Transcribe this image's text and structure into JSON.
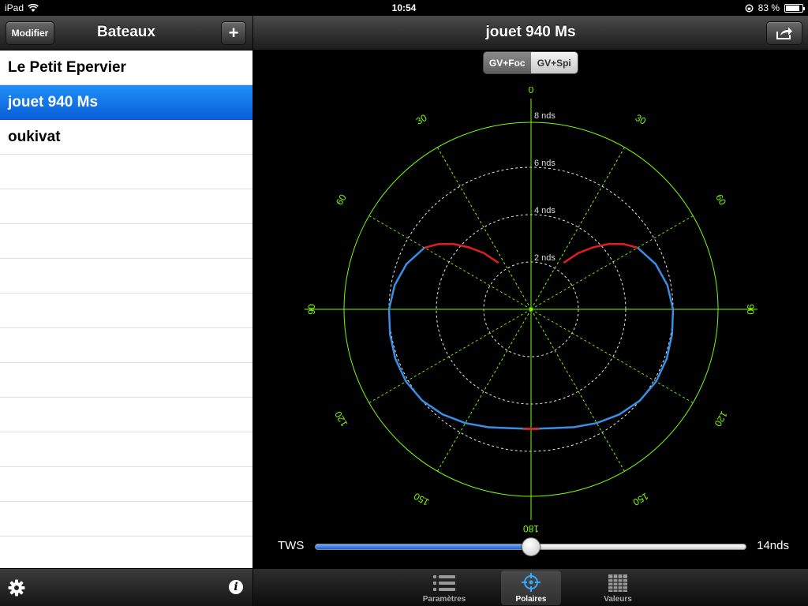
{
  "status": {
    "device": "iPad",
    "time": "10:54",
    "battery": "83 %",
    "battery_level": 0.83
  },
  "left": {
    "title": "Bateaux",
    "edit_label": "Modifier",
    "add_label": "+",
    "boats": [
      "Le Petit Epervier",
      "jouet 940 Ms",
      "oukivat"
    ],
    "selected_index": 1
  },
  "right": {
    "title": "jouet 940 Ms",
    "segments": [
      "GV+Foc",
      "GV+Spi"
    ],
    "selected_segment": 0
  },
  "polar": {
    "angle_labels": [
      "0",
      "30",
      "60",
      "90",
      "120",
      "150",
      "180",
      "150",
      "120",
      "90",
      "60",
      "30"
    ],
    "speed_labels": [
      "2 nds",
      "4 nds",
      "6 nds",
      "8 nds"
    ],
    "colors": {
      "grid": "#7CFC00",
      "curve": "#3a8ee6",
      "curve_highlight": "#e02020"
    },
    "curve": [
      [
        35,
        2.4
      ],
      [
        40,
        3.1
      ],
      [
        45,
        3.7
      ],
      [
        50,
        4.3
      ],
      [
        55,
        4.8
      ],
      [
        60,
        5.2
      ],
      [
        70,
        5.6
      ],
      [
        80,
        5.85
      ],
      [
        90,
        6.0
      ],
      [
        100,
        6.05
      ],
      [
        110,
        6.1
      ],
      [
        120,
        6.1
      ],
      [
        130,
        6.0
      ],
      [
        140,
        5.8
      ],
      [
        150,
        5.55
      ],
      [
        160,
        5.3
      ],
      [
        170,
        5.1
      ],
      [
        180,
        5.05
      ]
    ]
  },
  "tws": {
    "label": "TWS",
    "value": "14nds",
    "fraction": 0.5
  },
  "tabs": [
    {
      "label": "Paramètres",
      "icon": "list-icon",
      "active": false
    },
    {
      "label": "Polaires",
      "icon": "crosshair-icon",
      "active": true
    },
    {
      "label": "Valeurs",
      "icon": "table-icon",
      "active": false
    }
  ]
}
